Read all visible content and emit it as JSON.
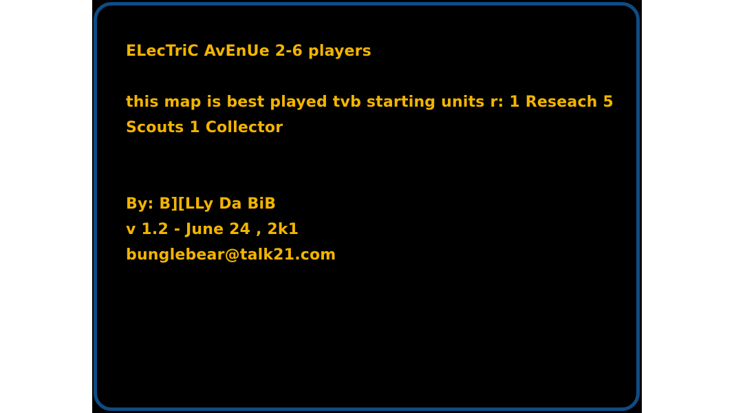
{
  "briefing": {
    "title": "ELecTriC AvEnUe 2-6 players",
    "description_line1": "this map is best played tvb starting units r: 1 Reseach 5",
    "description_line2": "Scouts 1 Collector",
    "author": "By: B][LLy Da BiB",
    "version": "v 1.2 - June 24 , 2k1",
    "email": "bunglebear@talk21.com"
  },
  "colors": {
    "text": "#f2b400",
    "border": "#0e4c85",
    "background": "#000000"
  }
}
